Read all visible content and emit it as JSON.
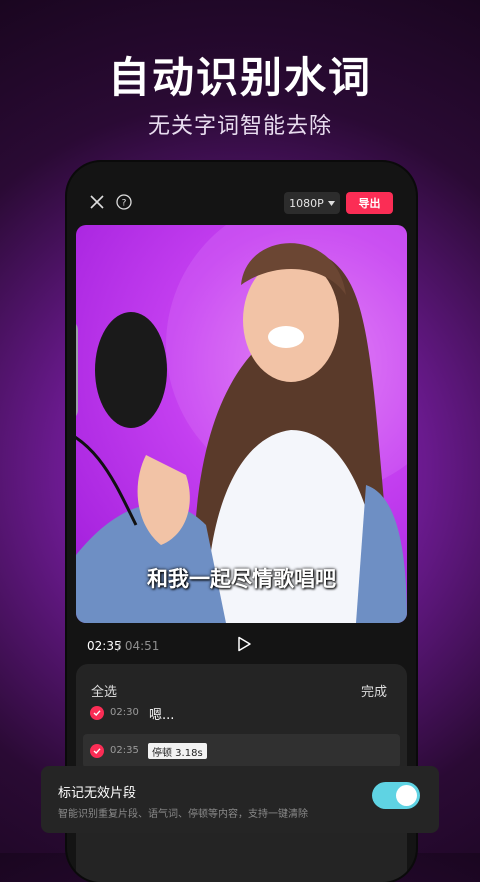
{
  "hero": {
    "title": "自动识别水词",
    "subtitle": "无关字词智能去除"
  },
  "toolbar": {
    "close_icon": "close-icon",
    "help_icon": "help-icon",
    "resolution": "1080P",
    "export_label": "导出"
  },
  "video": {
    "caption": "和我一起尽情歌唱吧"
  },
  "playback": {
    "current_time": "02:35",
    "total_time": "/ 04:51",
    "play_icon": "play-icon"
  },
  "panel": {
    "select_all": "全选",
    "done": "完成",
    "rows": [
      {
        "timestamp": "02:30",
        "word": "嗯..."
      },
      {
        "timestamp": "02:35",
        "pause": "停顿 3.18s"
      }
    ]
  },
  "bottom_card": {
    "title": "标记无效片段",
    "description": "智能识别重复片段、语气词、停顿等内容，支持一键清除",
    "toggle_on": true
  },
  "colors": {
    "accent": "#fb2d55",
    "toggle": "#5fd3e3"
  }
}
